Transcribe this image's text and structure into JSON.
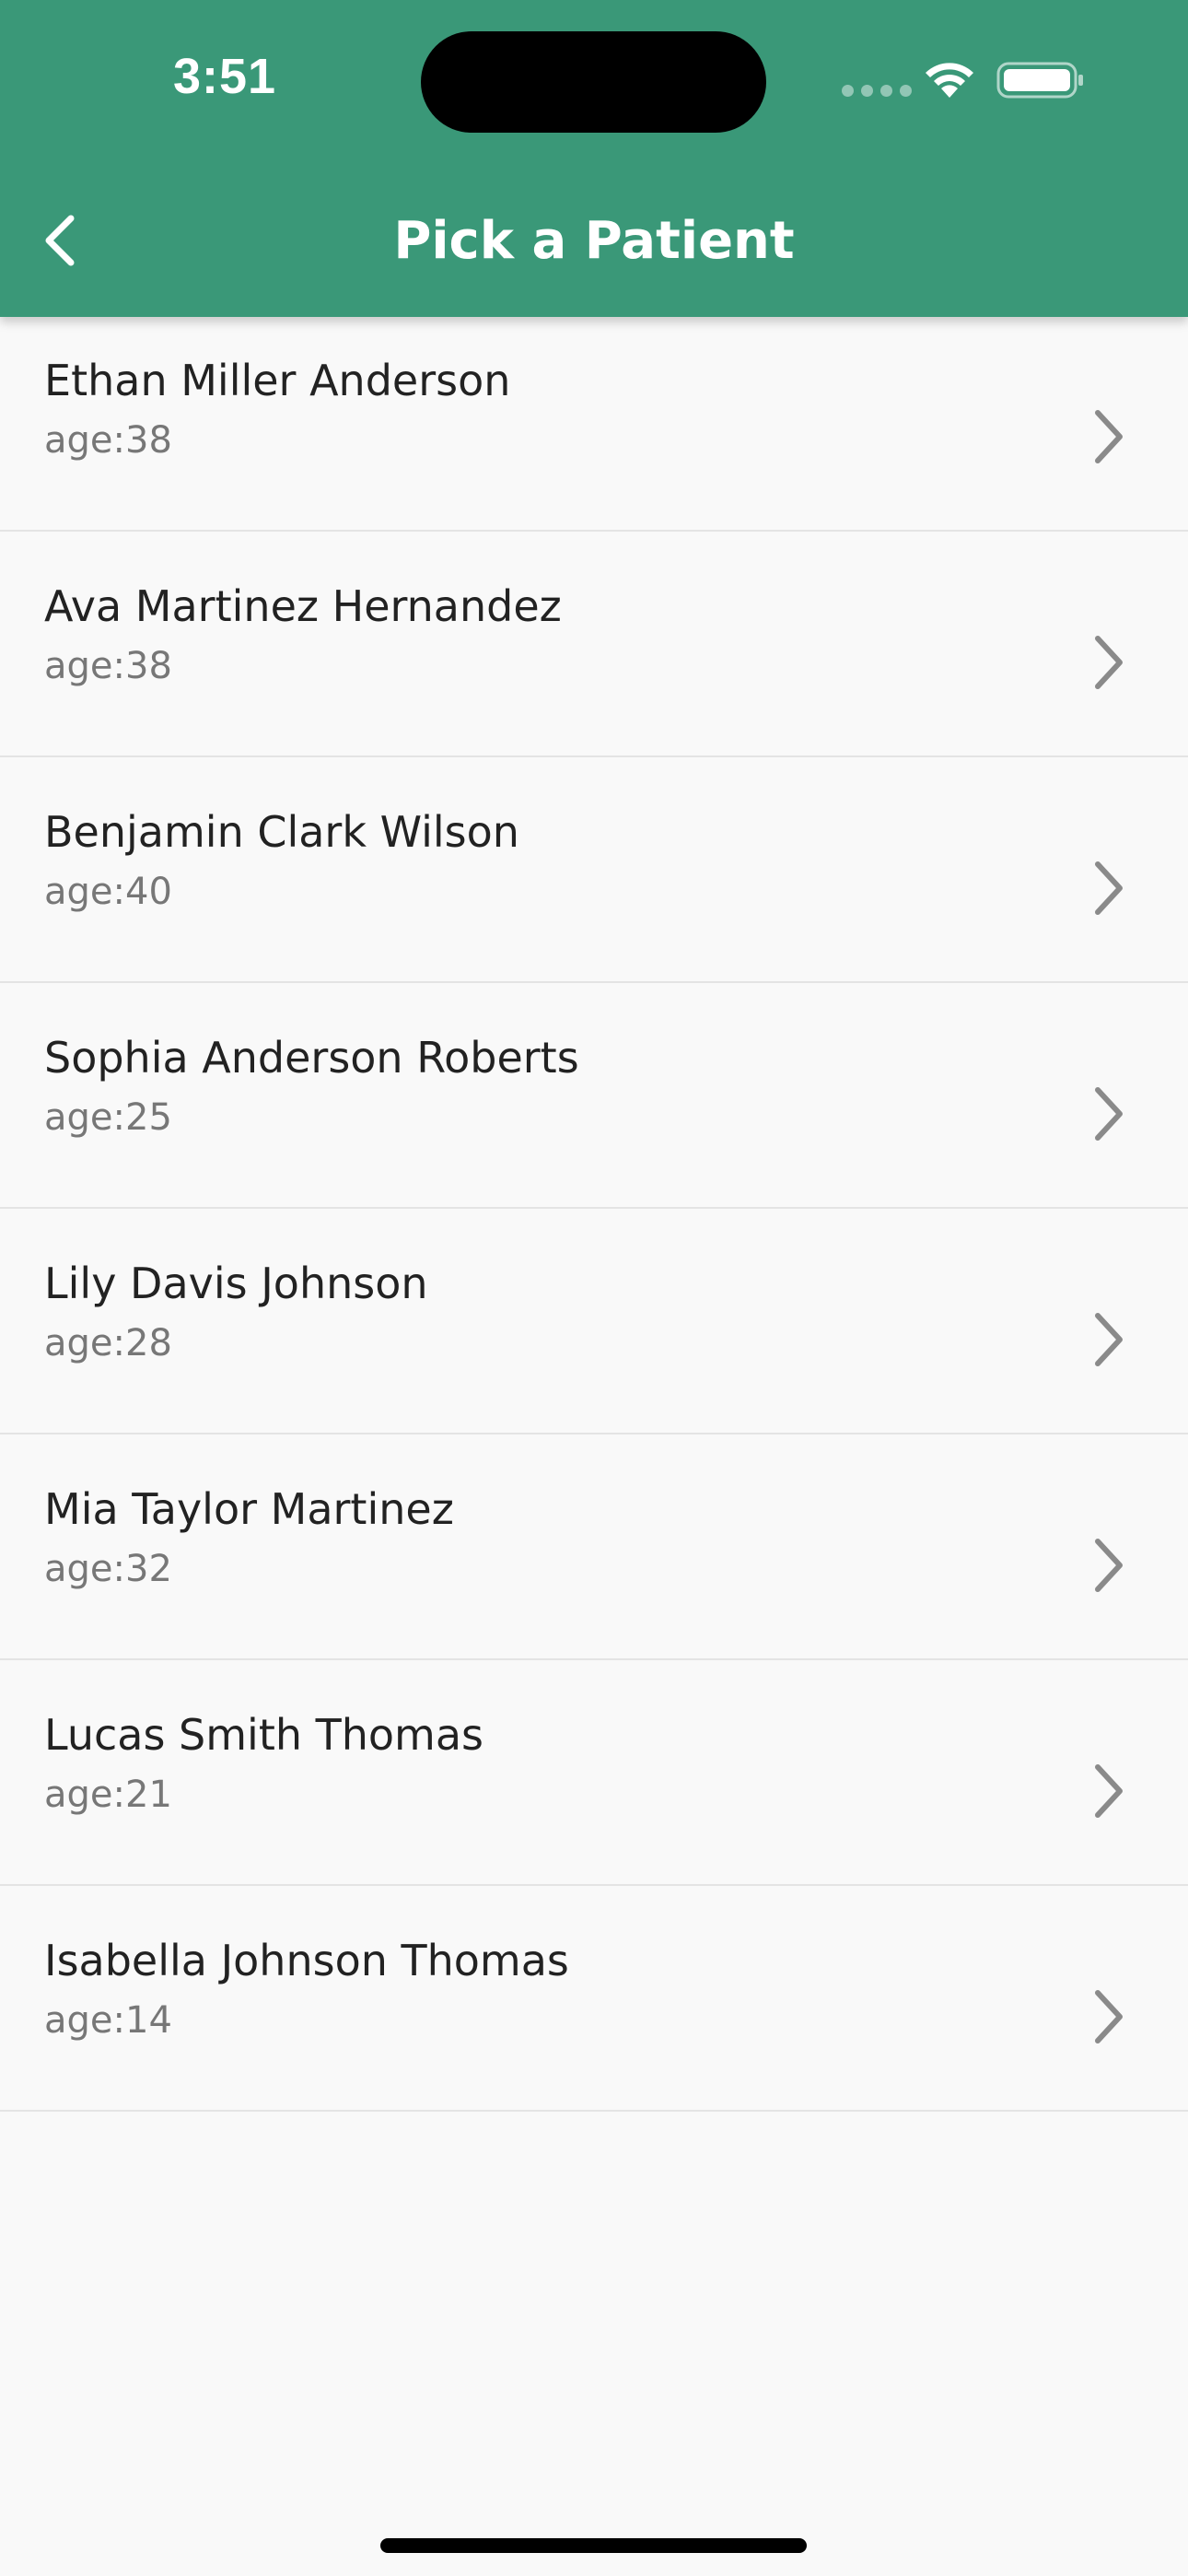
{
  "status_bar": {
    "time": "3:51"
  },
  "header": {
    "title": "Pick a Patient",
    "back_icon": "chevron-left-icon",
    "background": "#3a9878"
  },
  "patients": [
    {
      "name": "Ethan Miller Anderson",
      "age": "age:38"
    },
    {
      "name": "Ava Martinez Hernandez",
      "age": "age:38"
    },
    {
      "name": "Benjamin Clark Wilson",
      "age": "age:40"
    },
    {
      "name": "Sophia Anderson Roberts",
      "age": "age:25"
    },
    {
      "name": "Lily Davis Johnson",
      "age": "age:28"
    },
    {
      "name": "Mia Taylor Martinez",
      "age": "age:32"
    },
    {
      "name": "Lucas Smith Thomas",
      "age": "age:21"
    },
    {
      "name": "Isabella Johnson Thomas",
      "age": "age:14"
    }
  ]
}
